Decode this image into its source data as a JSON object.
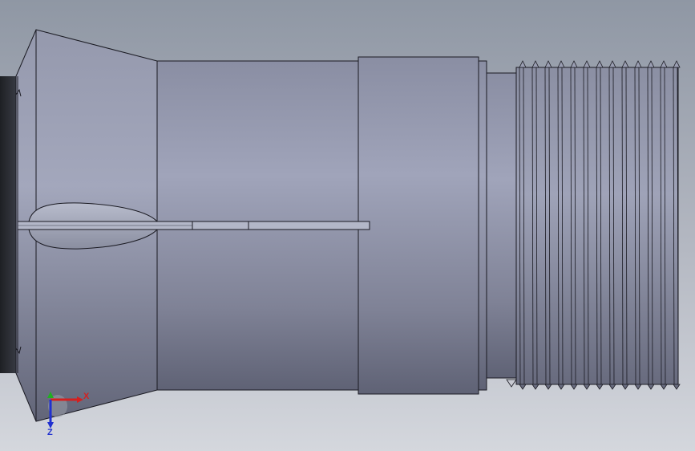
{
  "viewport": {
    "background_top": "#8f97a4",
    "background_bottom": "#d4d7dd"
  },
  "model": {
    "body_light": "#a0a4ba",
    "body_dark": "#5f6275",
    "edge_color": "#1a1a22"
  },
  "triad": {
    "x_label": "X",
    "y_label": "Y",
    "z_label": "Z",
    "x_color": "#d42020",
    "y_color": "#20b020",
    "z_color": "#2030d0"
  }
}
